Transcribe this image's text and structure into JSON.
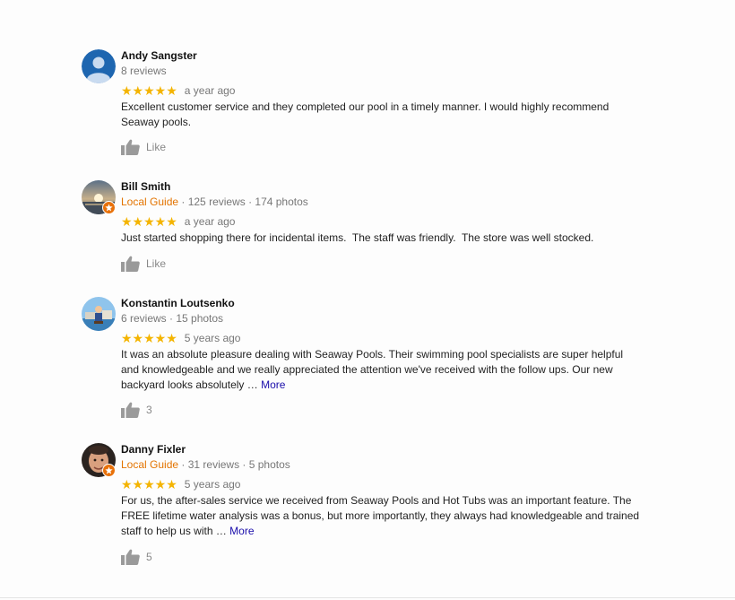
{
  "reviews": [
    {
      "name": "Andy Sangster",
      "local_guide": "",
      "meta": "8 reviews",
      "stars": "★★★★★",
      "time": "a year ago",
      "text": "Excellent customer service and they completed our pool in a timely manner. I would highly recommend Seaway pools.",
      "more": "",
      "like": "Like"
    },
    {
      "name": "Bill Smith",
      "local_guide": "Local Guide",
      "meta": " · 125 reviews · 174 photos",
      "stars": "★★★★★",
      "time": "a year ago",
      "text": "Just started shopping there for incidental items.  The staff was friendly.  The store was well stocked.",
      "more": "",
      "like": "Like"
    },
    {
      "name": "Konstantin Loutsenko",
      "local_guide": "",
      "meta": "6 reviews · 15 photos",
      "stars": "★★★★★",
      "time": "5 years ago",
      "text": "It was an absolute pleasure dealing with Seaway Pools. Their swimming pool specialists are super helpful and knowledgeable and we really appreciated the attention we've received with the follow ups. Our new backyard looks absolutely … ",
      "more": "More",
      "like": "3"
    },
    {
      "name": "Danny Fixler",
      "local_guide": "Local Guide",
      "meta": " · 31 reviews · 5 photos",
      "stars": "★★★★★",
      "time": "5 years ago",
      "text": "For us, the after-sales service we received from Seaway Pools and Hot Tubs was an important feature. The FREE lifetime water analysis was a bonus, but more importantly, they always had knowledgeable and trained staff to help us with … ",
      "more": "More",
      "like": "5"
    }
  ],
  "colors": {
    "star": "#f4b400",
    "local_guide": "#e37400",
    "more_link": "#1a0dab"
  },
  "icons": [
    "default-avatar-icon",
    "local-guide-badge-icon",
    "star-icon",
    "thumbs-up-icon"
  ]
}
